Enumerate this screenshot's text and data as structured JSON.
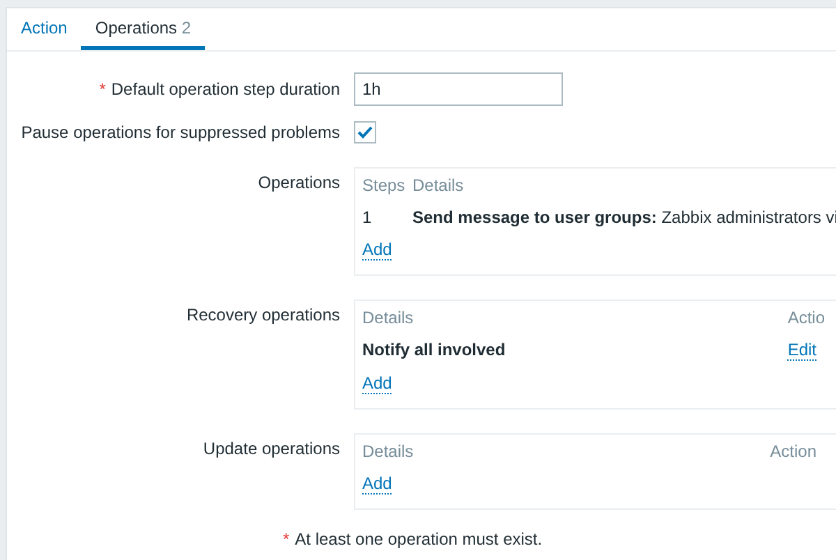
{
  "tabs": [
    {
      "label": "Action",
      "selected": false
    },
    {
      "label": "Operations",
      "count": "2",
      "selected": true
    }
  ],
  "step_duration": {
    "label": "Default operation step duration",
    "required_mark": "*",
    "value": "1h"
  },
  "pause_suppressed": {
    "label": "Pause operations for suppressed problems",
    "checked": true
  },
  "operations": {
    "label": "Operations",
    "columns": [
      "Steps",
      "Details"
    ],
    "rows": [
      {
        "steps": "1",
        "details": "**Send message to user groups:** Zabbix administrators vi"
      }
    ],
    "add": "Add"
  },
  "recovery_operations": {
    "label": "Recovery operations",
    "columns": [
      "Details",
      "Actio"
    ],
    "rows": [
      {
        "details": "Notify all involved",
        "action": "Edit"
      }
    ],
    "add": "Add"
  },
  "update_operations": {
    "label": "Update operations",
    "columns": [
      "Details",
      "Action"
    ],
    "add": "Add"
  },
  "footer_note": {
    "required_mark": "*",
    "text": "At least one operation must exist."
  }
}
